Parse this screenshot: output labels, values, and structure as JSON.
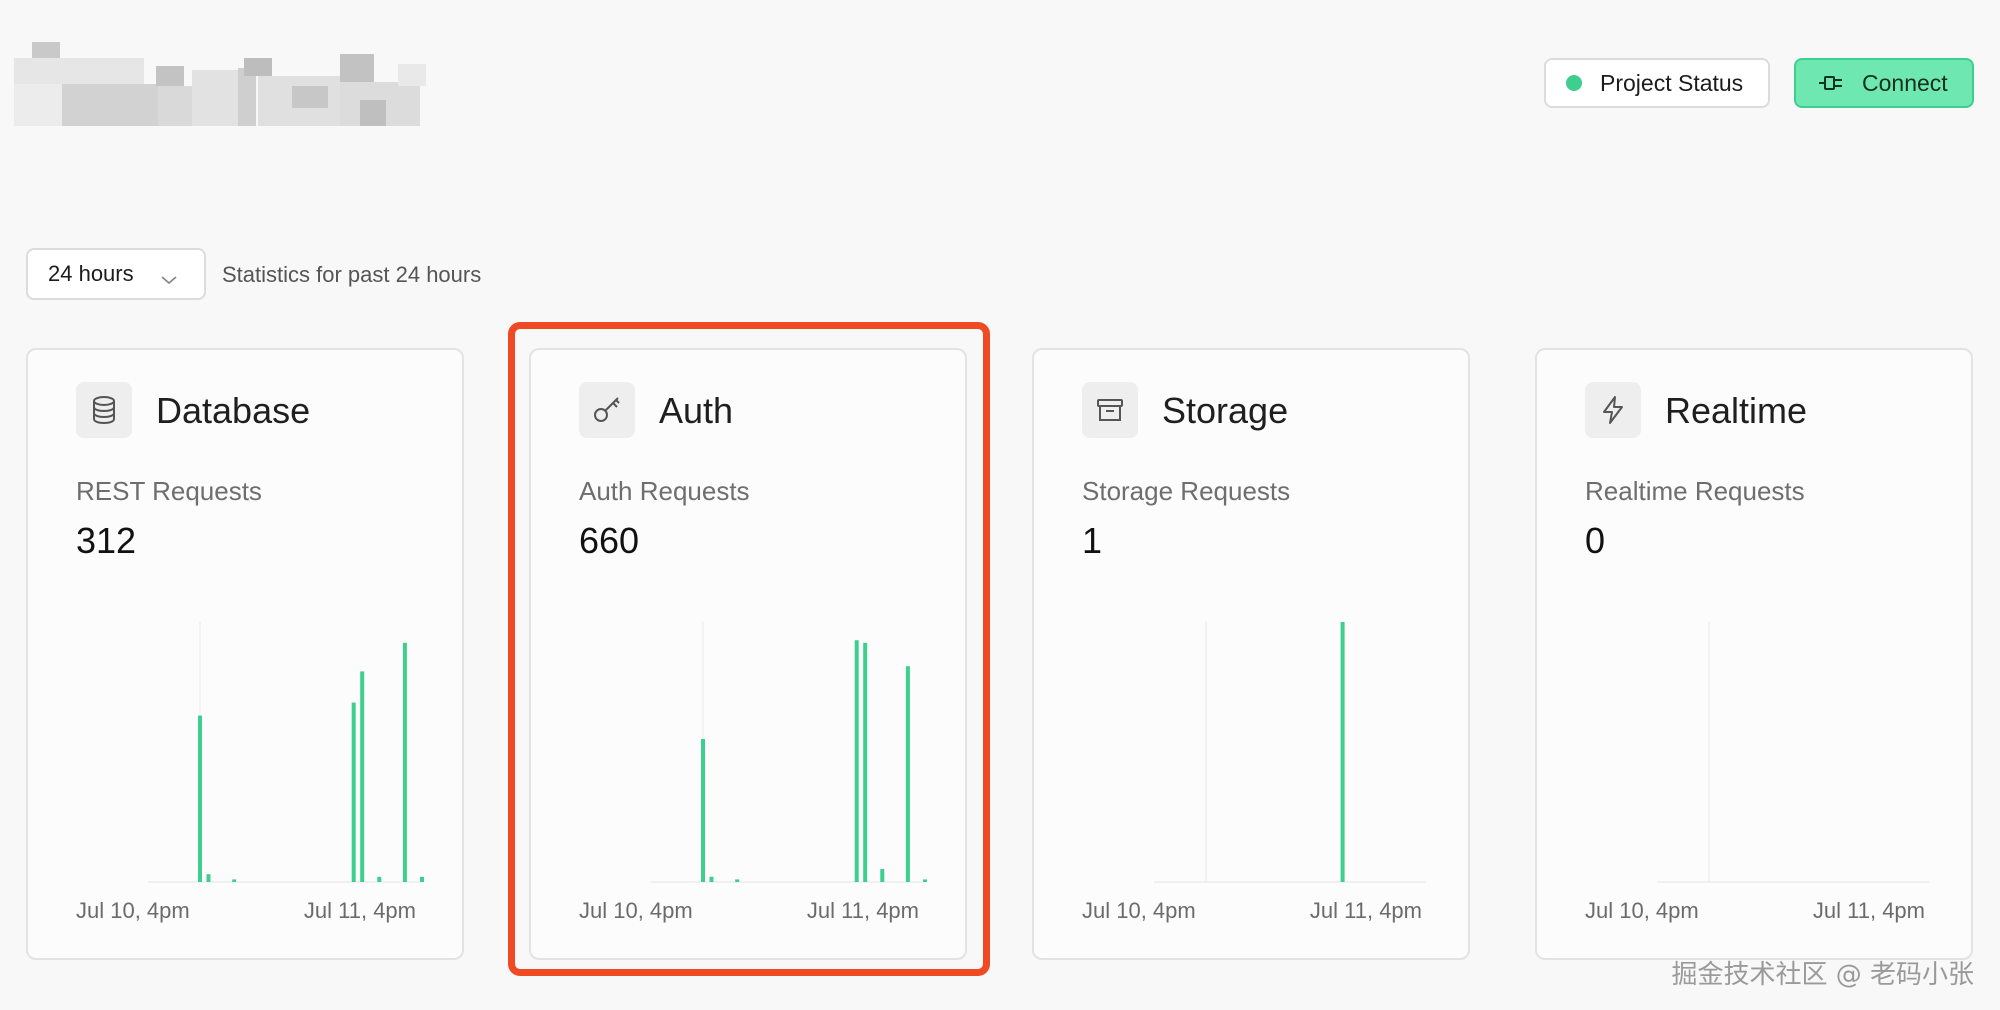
{
  "header": {
    "project_status_label": "Project Status",
    "connect_label": "Connect"
  },
  "period": {
    "selected": "24 hours",
    "description": "Statistics for past 24 hours"
  },
  "cards": [
    {
      "title": "Database",
      "icon": "database-icon",
      "metric": "REST Requests",
      "value": "312",
      "x_start": "Jul 10, 4pm",
      "x_end": "Jul 11, 4pm",
      "bars": [
        0.64,
        0.03,
        0,
        0,
        0.01,
        0,
        0,
        0,
        0,
        0,
        0,
        0,
        0,
        0,
        0,
        0,
        0,
        0,
        0.69,
        0.81,
        0,
        0.02,
        0,
        0,
        0.92,
        0,
        0.02
      ]
    },
    {
      "title": "Auth",
      "icon": "key-icon",
      "metric": "Auth Requests",
      "value": "660",
      "x_start": "Jul 10, 4pm",
      "x_end": "Jul 11, 4pm",
      "bars": [
        0.55,
        0.02,
        0,
        0,
        0.01,
        0,
        0,
        0,
        0,
        0,
        0,
        0,
        0,
        0,
        0,
        0,
        0,
        0,
        0.93,
        0.92,
        0,
        0.05,
        0,
        0,
        0.83,
        0,
        0.01
      ]
    },
    {
      "title": "Storage",
      "icon": "archive-icon",
      "metric": "Storage Requests",
      "value": "1",
      "x_start": "Jul 10, 4pm",
      "x_end": "Jul 11, 4pm",
      "bars": [
        0,
        0,
        0,
        0,
        0,
        0,
        0,
        0,
        0,
        0,
        0,
        0,
        0,
        0,
        0,
        0,
        1.0,
        0,
        0,
        0,
        0,
        0,
        0,
        0,
        0,
        0,
        0
      ]
    },
    {
      "title": "Realtime",
      "icon": "bolt-icon",
      "metric": "Realtime Requests",
      "value": "0",
      "x_start": "Jul 10, 4pm",
      "x_end": "Jul 11, 4pm",
      "bars": [
        0,
        0,
        0,
        0,
        0,
        0,
        0,
        0,
        0,
        0,
        0,
        0,
        0,
        0,
        0,
        0,
        0,
        0,
        0,
        0,
        0,
        0,
        0,
        0,
        0,
        0,
        0
      ]
    }
  ],
  "colors": {
    "accent": "#3ecf8e",
    "highlight": "#f04a24"
  },
  "watermark": "掘金技术社区 @ 老码小张"
}
